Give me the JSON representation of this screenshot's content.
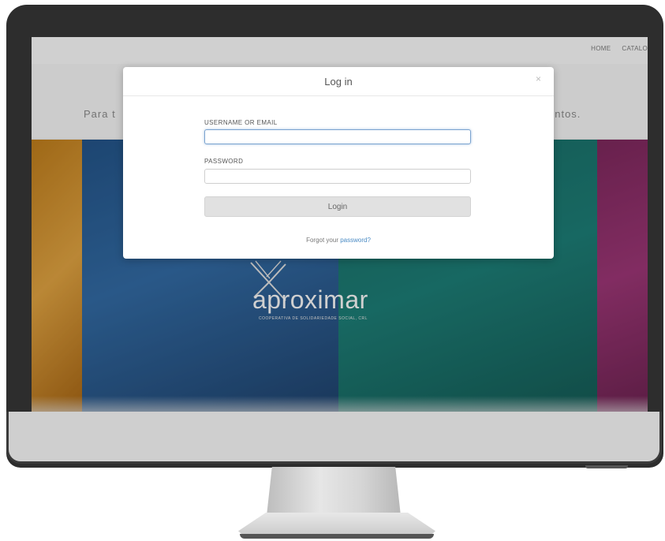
{
  "nav": {
    "items": [
      "HOME",
      "CATALO"
    ]
  },
  "intro": {
    "left_text": "Para t",
    "right_text": "entos."
  },
  "hero": {
    "logo_text": "aproximar",
    "logo_subtitle": "COOPERATIVA DE SOLIDARIEDADE SOCIAL, CRL"
  },
  "modal": {
    "title": "Log in",
    "close_icon": "close-icon",
    "username_label": "USERNAME OR EMAIL",
    "username_value": "",
    "password_label": "PASSWORD",
    "password_value": "",
    "login_button": "Login",
    "forgot_prefix": "Forgot your ",
    "forgot_link": "password?"
  },
  "colors": {
    "panel_orange": "#c07a12",
    "panel_blue": "#1a4e86",
    "panel_teal": "#0e6660",
    "panel_magenta": "#7a1f57",
    "link": "#4a8bc4"
  }
}
